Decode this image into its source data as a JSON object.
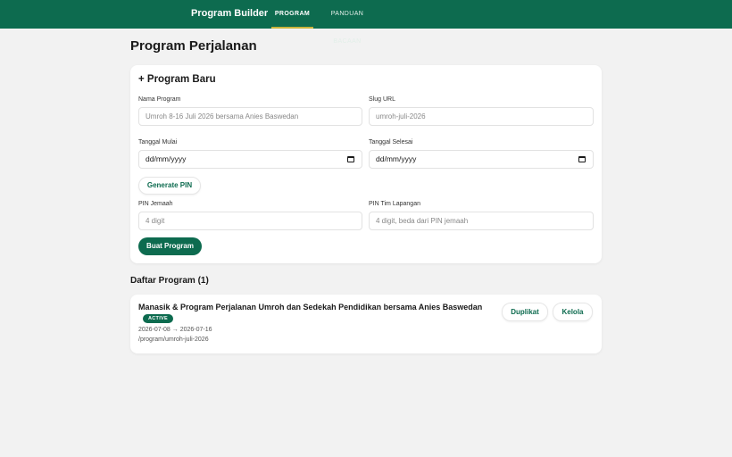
{
  "header": {
    "brand": "Program Builder",
    "tabs": [
      {
        "label": "PROGRAM"
      },
      {
        "label": "PANDUAN BACAAN"
      }
    ]
  },
  "page": {
    "title": "Program Perjalanan"
  },
  "form": {
    "title": "+ Program Baru",
    "name_label": "Nama Program",
    "name_placeholder": "Umroh 8-16 Juli 2026 bersama Anies Baswedan",
    "slug_label": "Slug URL",
    "slug_placeholder": "umroh-juli-2026",
    "start_label": "Tanggal Mulai",
    "start_value": "dd/mm/yyyy",
    "end_label": "Tanggal Selesai",
    "end_value": "dd/mm/yyyy",
    "generate_pin_label": "Generate PIN",
    "pin_jemaah_label": "PIN Jemaah",
    "pin_jemaah_placeholder": "4 digit",
    "pin_tim_label": "PIN Tim Lapangan",
    "pin_tim_placeholder": "4 digit, beda dari PIN jemaah",
    "submit_label": "Buat Program"
  },
  "list": {
    "title": "Daftar Program (1)",
    "items": [
      {
        "title": "Manasik & Program Perjalanan Umroh dan Sedekah Pendidikan bersama Anies Baswedan",
        "status": "ACTIVE",
        "dates": "2026-07-08 → 2026-07-16",
        "path": "/program/umroh-juli-2026",
        "duplicate_label": "Duplikat",
        "manage_label": "Kelola"
      }
    ]
  },
  "colors": {
    "primary": "#0d6b4f",
    "accent": "#c9b43c",
    "background": "#f2f2f2"
  },
  "icons": {
    "date_picker": "calendar-icon"
  }
}
